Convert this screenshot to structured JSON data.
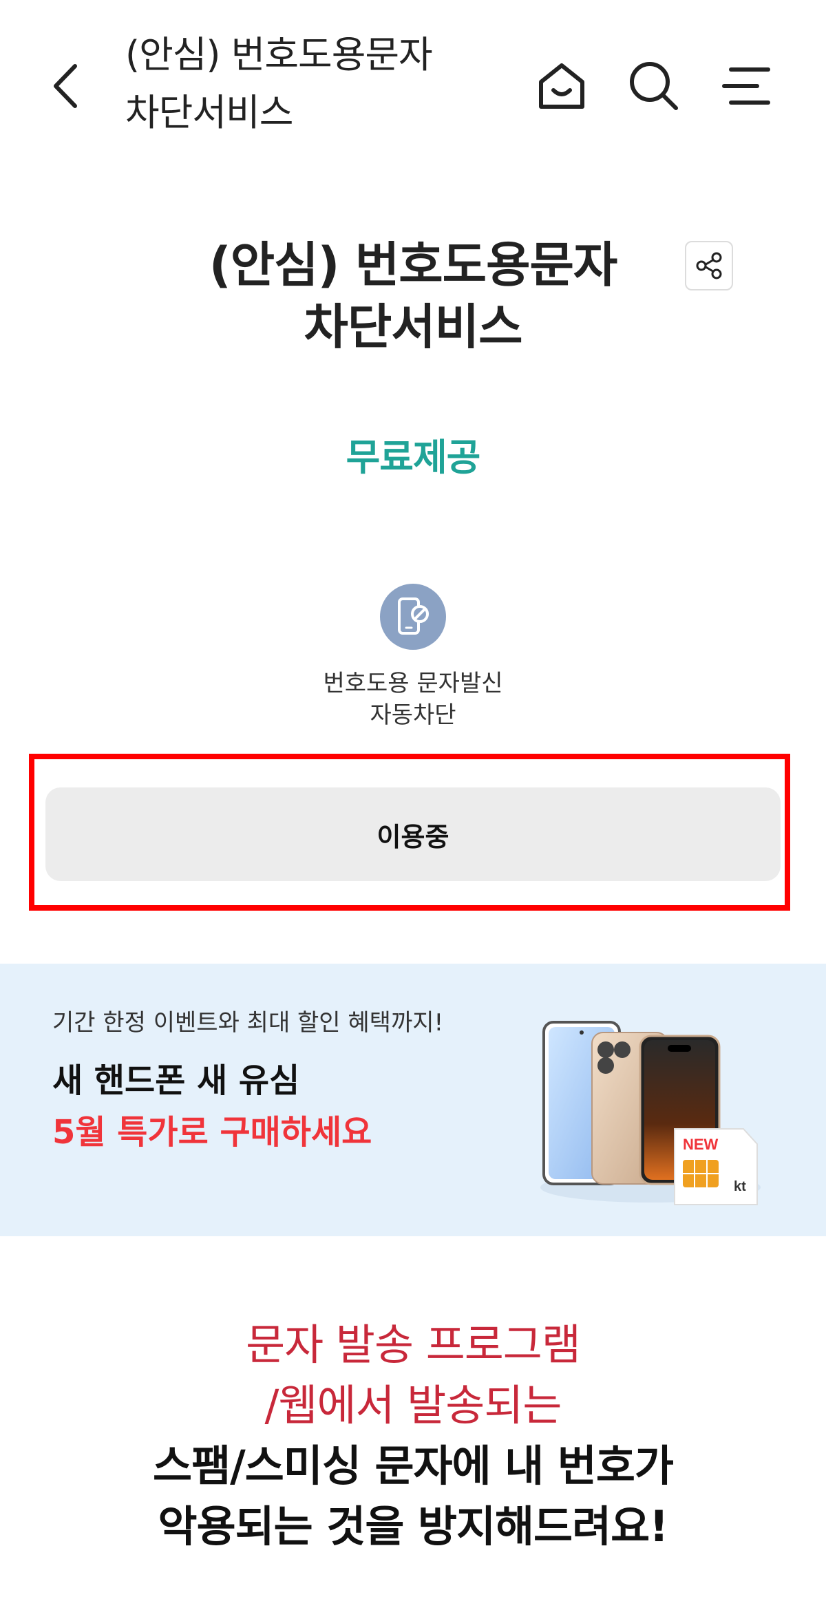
{
  "header": {
    "title_line1": "(안심) 번호도용문자",
    "title_line2": "차단서비스"
  },
  "product": {
    "title_line1": "(안심) 번호도용문자",
    "title_line2": "차단서비스",
    "price_label": "무료제공"
  },
  "feature": {
    "label_line1": "번호도용 문자발신",
    "label_line2": "자동차단"
  },
  "status_button": {
    "label": "이용중"
  },
  "promo": {
    "eyebrow": "기간 한정 이벤트와 최대 할인 혜택까지!",
    "headline": "새 핸드폰 새 유심",
    "subheadline": "5월 특가로 구매하세요",
    "sim_badge": "NEW",
    "sim_brand": "kt"
  },
  "description": {
    "line1": "문자 발송 프로그램",
    "line2": "/웹에서 발송되는",
    "line3": "스팸/스미싱 문자에 내 번호가",
    "line4": "악용되는 것을 방지해드려요!"
  },
  "colors": {
    "accent": "#1fa397",
    "highlight": "#ff0000",
    "promo_red": "#f0343a",
    "desc_red": "#c8283a",
    "banner_bg": "#e5f1fb"
  }
}
